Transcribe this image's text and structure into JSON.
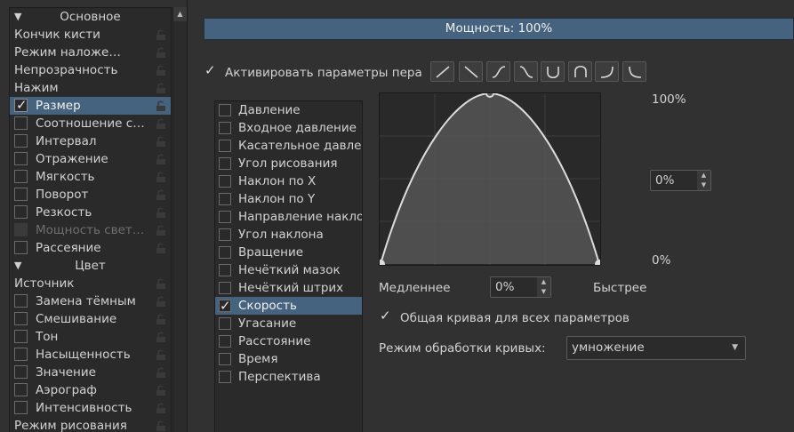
{
  "left_list": {
    "groups": [
      {
        "header": "Основное",
        "items": [
          {
            "label": "Кончик кисти",
            "checkable": false
          },
          {
            "label": "Режим наложения",
            "checkable": false
          },
          {
            "label": "Непрозрачность",
            "checkable": false
          },
          {
            "label": "Нажим",
            "checkable": false
          },
          {
            "label": "Размер",
            "checkable": true,
            "checked": true,
            "selected": true
          },
          {
            "label": "Соотношение ст...",
            "checkable": true,
            "checked": false
          },
          {
            "label": "Интервал",
            "checkable": true,
            "checked": false
          },
          {
            "label": "Отражение",
            "checkable": true,
            "checked": false
          },
          {
            "label": "Мягкость",
            "checkable": true,
            "checked": false
          },
          {
            "label": "Поворот",
            "checkable": true,
            "checked": false
          },
          {
            "label": "Резкость",
            "checkable": true,
            "checked": false
          },
          {
            "label": "Мощность светл...",
            "checkable": true,
            "checked": false,
            "disabled": true
          },
          {
            "label": "Рассеяние",
            "checkable": true,
            "checked": false
          }
        ]
      },
      {
        "header": "Цвет",
        "items": [
          {
            "label": "Источник",
            "checkable": false
          },
          {
            "label": "Замена тёмным",
            "checkable": true,
            "checked": false
          },
          {
            "label": "Смешивание",
            "checkable": true,
            "checked": false
          },
          {
            "label": "Тон",
            "checkable": true,
            "checked": false
          },
          {
            "label": "Насыщенность",
            "checkable": true,
            "checked": false
          },
          {
            "label": "Значение",
            "checkable": true,
            "checked": false
          },
          {
            "label": "Аэрограф",
            "checkable": true,
            "checked": false
          },
          {
            "label": "Интенсивность",
            "checkable": true,
            "checked": false
          },
          {
            "label": "Режим рисования",
            "checkable": false
          }
        ]
      }
    ]
  },
  "strength": "Мощность: 100%",
  "pen": {
    "enable_label": "Активировать параметры пера",
    "enabled": true,
    "presets": [
      "linear-curve-icon",
      "reverse-linear-curve-icon",
      "s-curve-icon",
      "reverse-s-curve-icon",
      "u-curve-icon",
      "arch-curve-icon",
      "ease-out-curve-icon",
      "ease-in-curve-icon"
    ]
  },
  "sensors": [
    {
      "label": "Давление",
      "checked": false
    },
    {
      "label": "Входное давление",
      "checked": false
    },
    {
      "label": "Касательное давлен",
      "checked": false
    },
    {
      "label": "Угол рисования",
      "checked": false
    },
    {
      "label": "Наклон по X",
      "checked": false
    },
    {
      "label": "Наклон по Y",
      "checked": false
    },
    {
      "label": "Направление накло",
      "checked": false
    },
    {
      "label": "Угол наклона",
      "checked": false
    },
    {
      "label": "Вращение",
      "checked": false
    },
    {
      "label": "Нечёткий мазок",
      "checked": false
    },
    {
      "label": "Нечёткий штрих",
      "checked": false
    },
    {
      "label": "Скорость",
      "checked": true,
      "selected": true
    },
    {
      "label": "Угасание",
      "checked": false
    },
    {
      "label": "Расстояние",
      "checked": false
    },
    {
      "label": "Время",
      "checked": false
    },
    {
      "label": "Перспектива",
      "checked": false
    }
  ],
  "curve": {
    "max_label": "100%",
    "min_label": "0%",
    "offset_value": "0%",
    "slow_label": "Медленнее",
    "fast_label": "Быстрее",
    "speed_value": "0%"
  },
  "shared_curve": {
    "label": "Общая кривая для всех параметров",
    "checked": true
  },
  "mode": {
    "label": "Режим обработки кривых:",
    "value": "умножение"
  },
  "colors": {
    "selection": "#45627e",
    "background": "#313131",
    "list_bg": "#2a2a2a"
  }
}
